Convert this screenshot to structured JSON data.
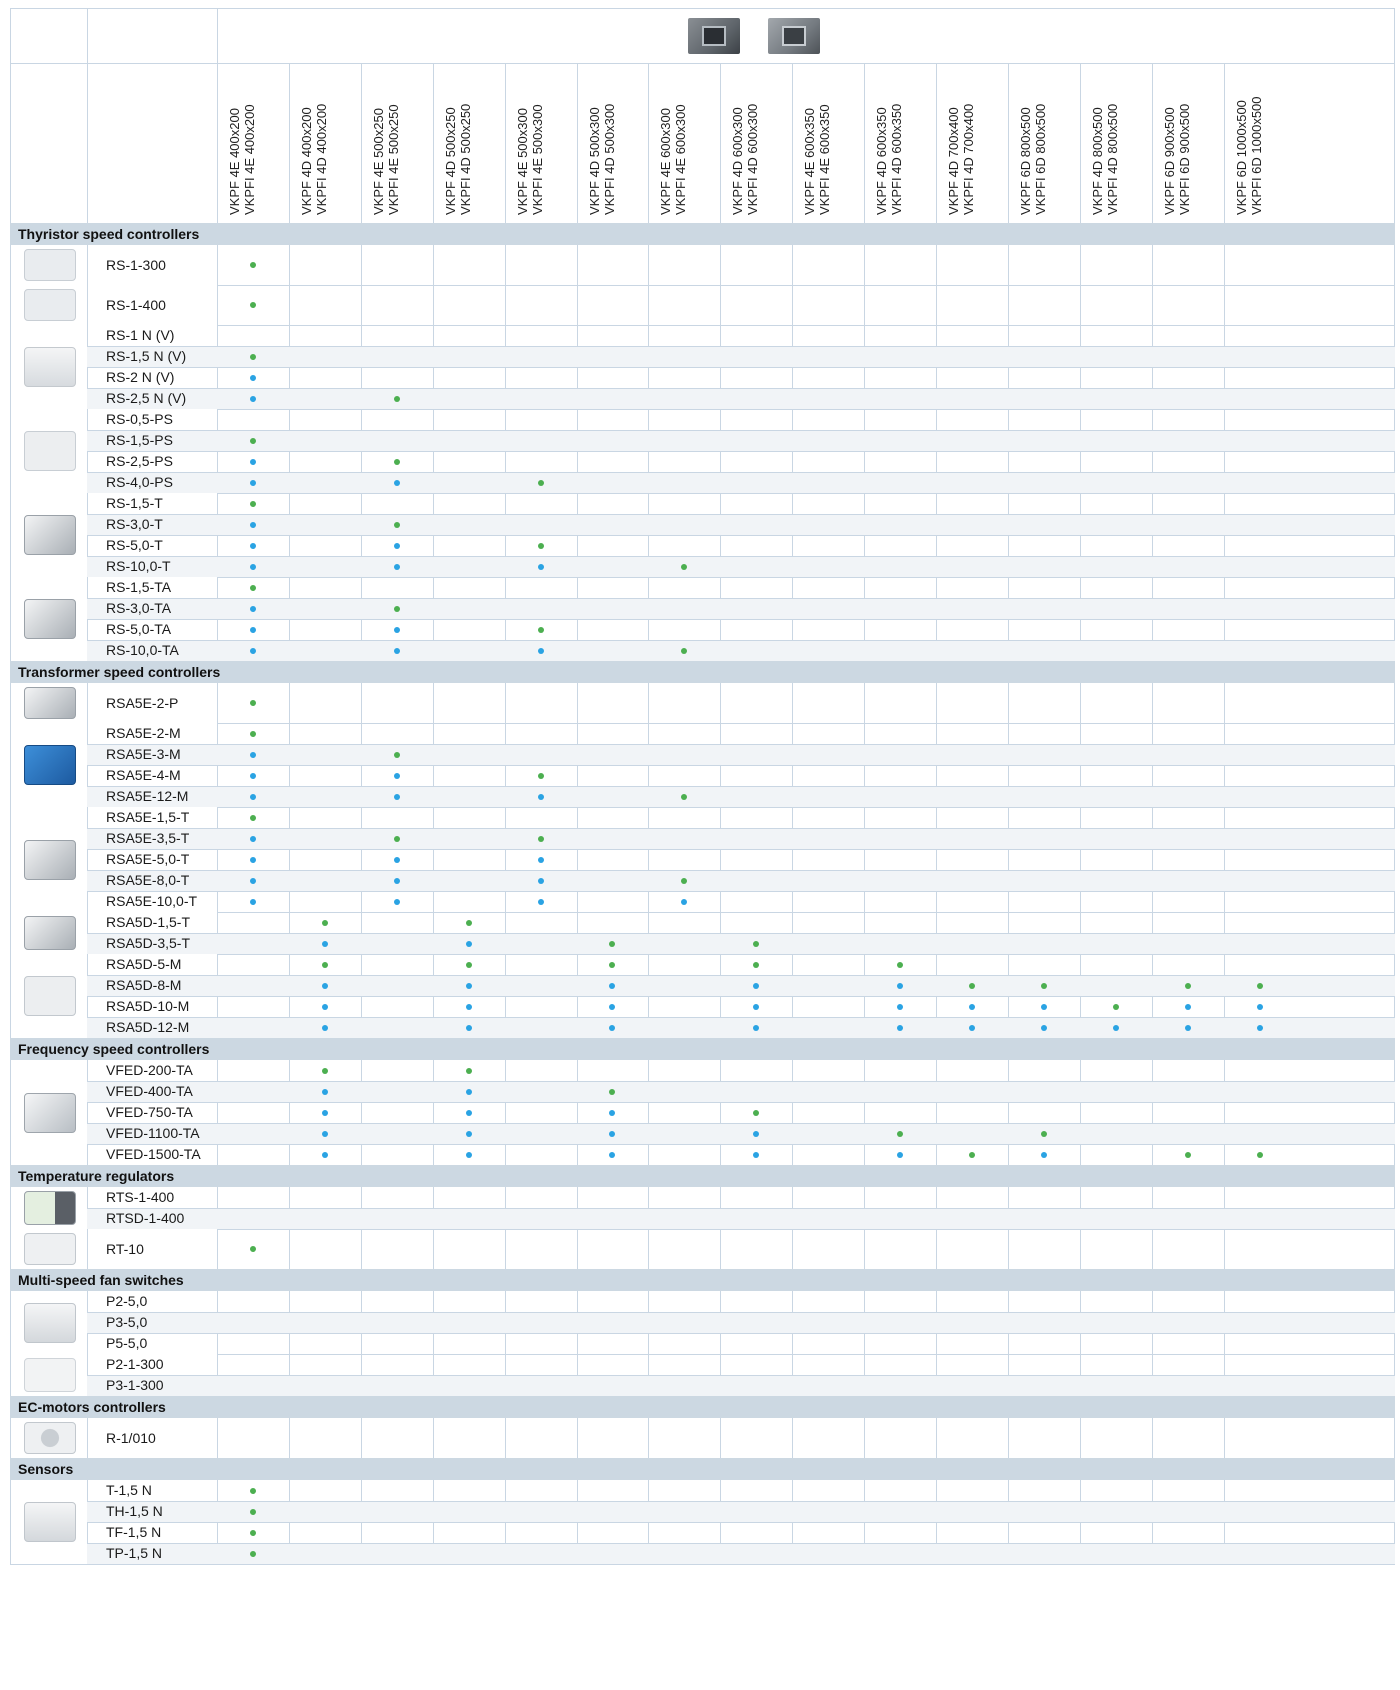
{
  "columns": [
    [
      "VKPF 4E 400x200",
      "VKPFI 4E 400x200"
    ],
    [
      "VKPF 4D 400x200",
      "VKPFI 4D 400x200"
    ],
    [
      "VKPF 4E 500x250",
      "VKPFI 4E 500x250"
    ],
    [
      "VKPF 4D 500x250",
      "VKPFI 4D 500x250"
    ],
    [
      "VKPF 4E 500x300",
      "VKPFI 4E 500x300"
    ],
    [
      "VKPF 4D 500x300",
      "VKPFI 4D 500x300"
    ],
    [
      "VKPF 4E 600x300",
      "VKPFI 4E 600x300"
    ],
    [
      "VKPF 4D 600x300",
      "VKPFI 4D 600x300"
    ],
    [
      "VKPF 4E 600x350",
      "VKPFI 4E 600x350"
    ],
    [
      "VKPF 4D 600x350",
      "VKPFI 4D 600x350"
    ],
    [
      "VKPF 4D 700x400",
      "VKPFI 4D 700x400"
    ],
    [
      "VKPF 6D 800x500",
      "VKPFI 6D 800x500"
    ],
    [
      "VKPF 4D 800x500",
      "VKPFI 4D 800x500"
    ],
    [
      "VKPF 6D 900x500",
      "VKPFI 6D 900x500"
    ],
    [
      "VKPF 6D 1000x500",
      "VKPFI 6D 1000x500"
    ]
  ],
  "colors": {
    "green": "#4caf50",
    "blue": "#2aa3e3",
    "grid": "#c9d6e3",
    "category_bg": "#ccd8e2"
  },
  "sections": [
    {
      "title": "Thyristor speed controllers",
      "groups": [
        {
          "icon": "dial-controller-icon",
          "rows": [
            {
              "name": "RS-1-300",
              "marks": {
                "0": "g"
              }
            }
          ]
        },
        {
          "icon": "dial-controller-icon",
          "rows": [
            {
              "name": "RS-1-400",
              "marks": {
                "0": "g"
              }
            }
          ]
        },
        {
          "icon": "wall-controller-icon",
          "rows": [
            {
              "name": "RS-1 N (V)",
              "marks": {}
            },
            {
              "name": "RS-1,5 N (V)",
              "marks": {
                "0": "g"
              }
            },
            {
              "name": "RS-2 N (V)",
              "marks": {
                "0": "b"
              }
            },
            {
              "name": "RS-2,5 N (V)",
              "marks": {
                "0": "b",
                "2": "g"
              }
            }
          ]
        },
        {
          "icon": "square-controller-icon",
          "rows": [
            {
              "name": "RS-0,5-PS",
              "marks": {}
            },
            {
              "name": "RS-1,5-PS",
              "marks": {
                "0": "g"
              }
            },
            {
              "name": "RS-2,5-PS",
              "marks": {
                "0": "b",
                "2": "g"
              }
            },
            {
              "name": "RS-4,0-PS",
              "marks": {
                "0": "b",
                "2": "b",
                "4": "g"
              }
            }
          ]
        },
        {
          "icon": "box-controller-icon",
          "rows": [
            {
              "name": "RS-1,5-T",
              "marks": {
                "0": "g"
              }
            },
            {
              "name": "RS-3,0-T",
              "marks": {
                "0": "b",
                "2": "g"
              }
            },
            {
              "name": "RS-5,0-T",
              "marks": {
                "0": "b",
                "2": "b",
                "4": "g"
              }
            },
            {
              "name": "RS-10,0-T",
              "marks": {
                "0": "b",
                "2": "b",
                "4": "b",
                "6": "g"
              }
            }
          ]
        },
        {
          "icon": "box-controller-icon",
          "rows": [
            {
              "name": "RS-1,5-TA",
              "marks": {
                "0": "g"
              }
            },
            {
              "name": "RS-3,0-TA",
              "marks": {
                "0": "b",
                "2": "g"
              }
            },
            {
              "name": "RS-5,0-TA",
              "marks": {
                "0": "b",
                "2": "b",
                "4": "g"
              }
            },
            {
              "name": "RS-10,0-TA",
              "marks": {
                "0": "b",
                "2": "b",
                "4": "b",
                "6": "g"
              }
            }
          ]
        }
      ]
    },
    {
      "title": "Transformer speed controllers",
      "groups": [
        {
          "icon": "box-controller-icon",
          "rows": [
            {
              "name": "RSA5E-2-P",
              "marks": {
                "0": "g"
              }
            }
          ]
        },
        {
          "icon": "blue-box-controller-icon",
          "rows": [
            {
              "name": "RSA5E-2-M",
              "marks": {
                "0": "g"
              }
            },
            {
              "name": "RSA5E-3-M",
              "marks": {
                "0": "b",
                "2": "g"
              }
            },
            {
              "name": "RSA5E-4-M",
              "marks": {
                "0": "b",
                "2": "b",
                "4": "g"
              }
            },
            {
              "name": "RSA5E-12-M",
              "marks": {
                "0": "b",
                "2": "b",
                "4": "b",
                "6": "g"
              }
            }
          ]
        },
        {
          "icon": "box-controller-icon",
          "rows": [
            {
              "name": "RSA5E-1,5-T",
              "marks": {
                "0": "g"
              }
            },
            {
              "name": "RSA5E-3,5-T",
              "marks": {
                "0": "b",
                "2": "g",
                "4": "g"
              }
            },
            {
              "name": "RSA5E-5,0-T",
              "marks": {
                "0": "b",
                "2": "b",
                "4": "b"
              }
            },
            {
              "name": "RSA5E-8,0-T",
              "marks": {
                "0": "b",
                "2": "b",
                "4": "b",
                "6": "g"
              }
            },
            {
              "name": "RSA5E-10,0-T",
              "marks": {
                "0": "b",
                "2": "b",
                "4": "b",
                "6": "b"
              }
            }
          ]
        },
        {
          "icon": "box-controller-icon",
          "rows": [
            {
              "name": "RSA5D-1,5-T",
              "marks": {
                "1": "g",
                "3": "g"
              }
            },
            {
              "name": "RSA5D-3,5-T",
              "marks": {
                "1": "b",
                "3": "b",
                "5": "g",
                "7": "g"
              }
            }
          ]
        },
        {
          "icon": "cabinet-controller-icon",
          "rows": [
            {
              "name": "RSA5D-5-M",
              "marks": {
                "1": "g",
                "3": "g",
                "5": "g",
                "7": "g",
                "9": "g"
              }
            },
            {
              "name": "RSA5D-8-M",
              "marks": {
                "1": "b",
                "3": "b",
                "5": "b",
                "7": "b",
                "9": "b",
                "10": "g",
                "11": "g",
                "13": "g",
                "14": "g"
              }
            },
            {
              "name": "RSA5D-10-M",
              "marks": {
                "1": "b",
                "3": "b",
                "5": "b",
                "7": "b",
                "9": "b",
                "10": "b",
                "11": "b",
                "12": "g",
                "13": "b",
                "14": "b"
              }
            },
            {
              "name": "RSA5D-12-M",
              "marks": {
                "1": "b",
                "3": "b",
                "5": "b",
                "7": "b",
                "9": "b",
                "10": "b",
                "11": "b",
                "12": "b",
                "13": "b",
                "14": "b"
              }
            }
          ]
        }
      ]
    },
    {
      "title": "Frequency speed controllers",
      "groups": [
        {
          "icon": "frequency-drive-icon",
          "rows": [
            {
              "name": "VFED-200-TA",
              "marks": {
                "1": "g",
                "3": "g"
              }
            },
            {
              "name": "VFED-400-TA",
              "marks": {
                "1": "b",
                "3": "b",
                "5": "g"
              }
            },
            {
              "name": "VFED-750-TA",
              "marks": {
                "1": "b",
                "3": "b",
                "5": "b",
                "7": "g"
              }
            },
            {
              "name": "VFED-1100-TA",
              "marks": {
                "1": "b",
                "3": "b",
                "5": "b",
                "7": "b",
                "9": "g",
                "11": "g"
              }
            },
            {
              "name": "VFED-1500-TA",
              "marks": {
                "1": "b",
                "3": "b",
                "5": "b",
                "7": "b",
                "9": "b",
                "10": "g",
                "11": "b",
                "13": "g",
                "14": "g"
              }
            }
          ]
        }
      ]
    },
    {
      "title": "Temperature regulators",
      "groups": [
        {
          "icon": "thermostat-remote-icon",
          "rows": [
            {
              "name": "RTS-1-400",
              "marks": {}
            },
            {
              "name": "RTSD-1-400",
              "marks": {}
            }
          ]
        },
        {
          "icon": "thermostat-icon",
          "rows": [
            {
              "name": "RT-10",
              "marks": {
                "0": "g"
              }
            }
          ]
        }
      ]
    },
    {
      "title": "Multi-speed fan switches",
      "groups": [
        {
          "icon": "wall-switch-icon",
          "rows": [
            {
              "name": "P2-5,0",
              "marks": {}
            },
            {
              "name": "P3-5,0",
              "marks": {}
            },
            {
              "name": "P5-5,0",
              "marks": {}
            }
          ]
        },
        {
          "icon": "small-switch-icon",
          "rows": [
            {
              "name": "P2-1-300",
              "marks": {}
            },
            {
              "name": "P3-1-300",
              "marks": {}
            }
          ]
        }
      ]
    },
    {
      "title": "EC-motors controllers",
      "groups": [
        {
          "icon": "ec-dial-icon",
          "rows": [
            {
              "name": "R-1/010",
              "marks": {}
            }
          ]
        }
      ]
    },
    {
      "title": "Sensors",
      "groups": [
        {
          "icon": "sensor-box-icon",
          "rows": [
            {
              "name": "T-1,5 N",
              "marks": {
                "0": "g"
              }
            },
            {
              "name": "TH-1,5 N",
              "marks": {
                "0": "g"
              }
            },
            {
              "name": "TF-1,5 N",
              "marks": {
                "0": "g"
              }
            },
            {
              "name": "TP-1,5 N",
              "marks": {
                "0": "g"
              }
            }
          ]
        }
      ]
    }
  ]
}
